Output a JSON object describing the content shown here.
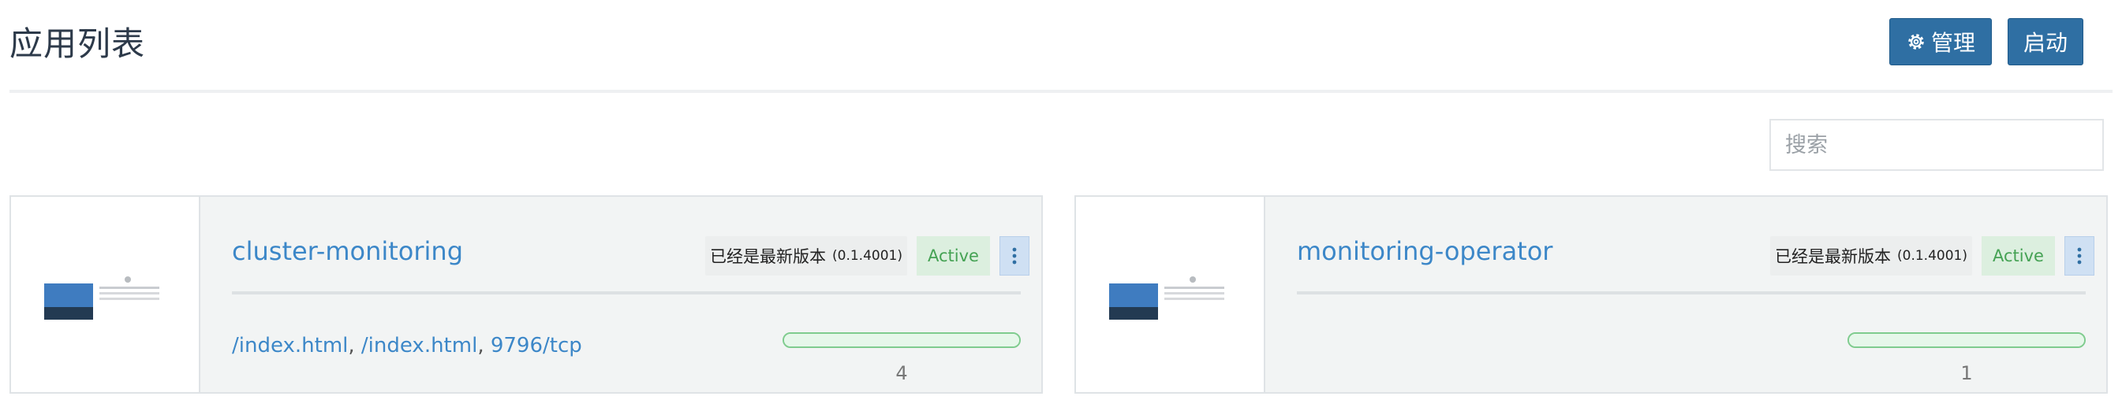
{
  "header": {
    "title": "应用列表",
    "manage_label": "管理",
    "start_label": "启动"
  },
  "search": {
    "placeholder": "搜索",
    "value": ""
  },
  "apps": [
    {
      "name": "cluster-monitoring",
      "version_text": "已经是最新版本",
      "version_num": "(0.1.4001)",
      "status": "Active",
      "endpoints": [
        "/index.html",
        "/index.html",
        "9796/tcp"
      ],
      "count": "4",
      "progress_fraction": 1.0
    },
    {
      "name": "monitoring-operator",
      "version_text": "已经是最新版本",
      "version_num": "(0.1.4001)",
      "status": "Active",
      "endpoints": [],
      "count": "1",
      "progress_fraction": 1.0
    }
  ],
  "colors": {
    "primary": "#2f6fa3",
    "link": "#3c87c8",
    "active_text": "#45a254",
    "active_bg": "#dcefdf"
  },
  "icons": {
    "manage": "gear-icon",
    "kebab": "vertical-dots-icon",
    "thumbnail": "app-thumbnail"
  }
}
